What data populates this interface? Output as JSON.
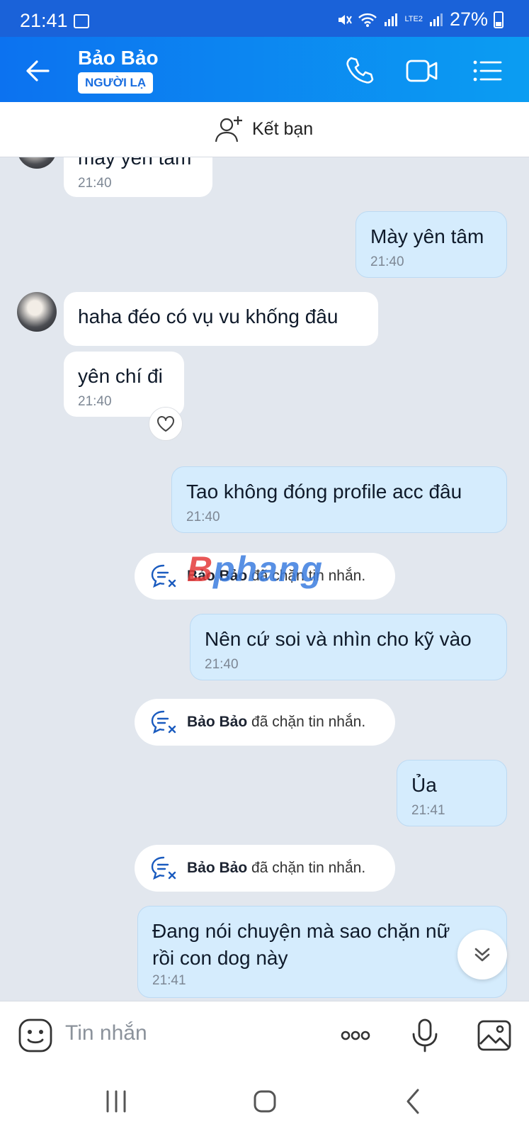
{
  "status": {
    "time": "21:41",
    "battery": "27%",
    "network": "LTE2"
  },
  "header": {
    "contact_name": "Bảo Bảo",
    "badge": "NGƯỜI LẠ"
  },
  "friend_bar": {
    "label": "Kết bạn"
  },
  "watermark": {
    "text_b": "B",
    "text_rest": "phang"
  },
  "messages": [
    {
      "dir": "in",
      "text": "mày yên tâm",
      "time": "21:40"
    },
    {
      "dir": "out",
      "text": "Mày yên tâm",
      "time": "21:40"
    },
    {
      "dir": "in",
      "text": "haha đéo có vụ vu khống đâu",
      "time": ""
    },
    {
      "dir": "in",
      "text": "yên chí đi",
      "time": "21:40"
    },
    {
      "dir": "out",
      "text": "Tao không đóng profile acc đâu",
      "time": "21:40"
    },
    {
      "dir": "out",
      "text": "Nên cứ soi và nhìn cho kỹ vào",
      "time": "21:40"
    },
    {
      "dir": "out",
      "text": "Ủa",
      "time": "21:41"
    },
    {
      "dir": "out",
      "text": "Đang nói chuyện mà sao chặn nữ",
      "text2": "rồi con dog này",
      "time": "21:41"
    }
  ],
  "system": [
    {
      "name": "Bảo Bảo",
      "text": " đã chặn tin nhắn."
    },
    {
      "name": "Bảo Bảo",
      "text": " đã chặn tin nhắn."
    },
    {
      "name": "Bảo Bảo",
      "text": " đã chặn tin nhắn."
    }
  ],
  "input": {
    "placeholder": "Tin nhắn"
  },
  "colors": {
    "header_start": "#0c72f0",
    "header_end": "#0b9df2",
    "outgoing_bubble": "#d5ecfd",
    "chat_bg": "#e2e7ee"
  }
}
